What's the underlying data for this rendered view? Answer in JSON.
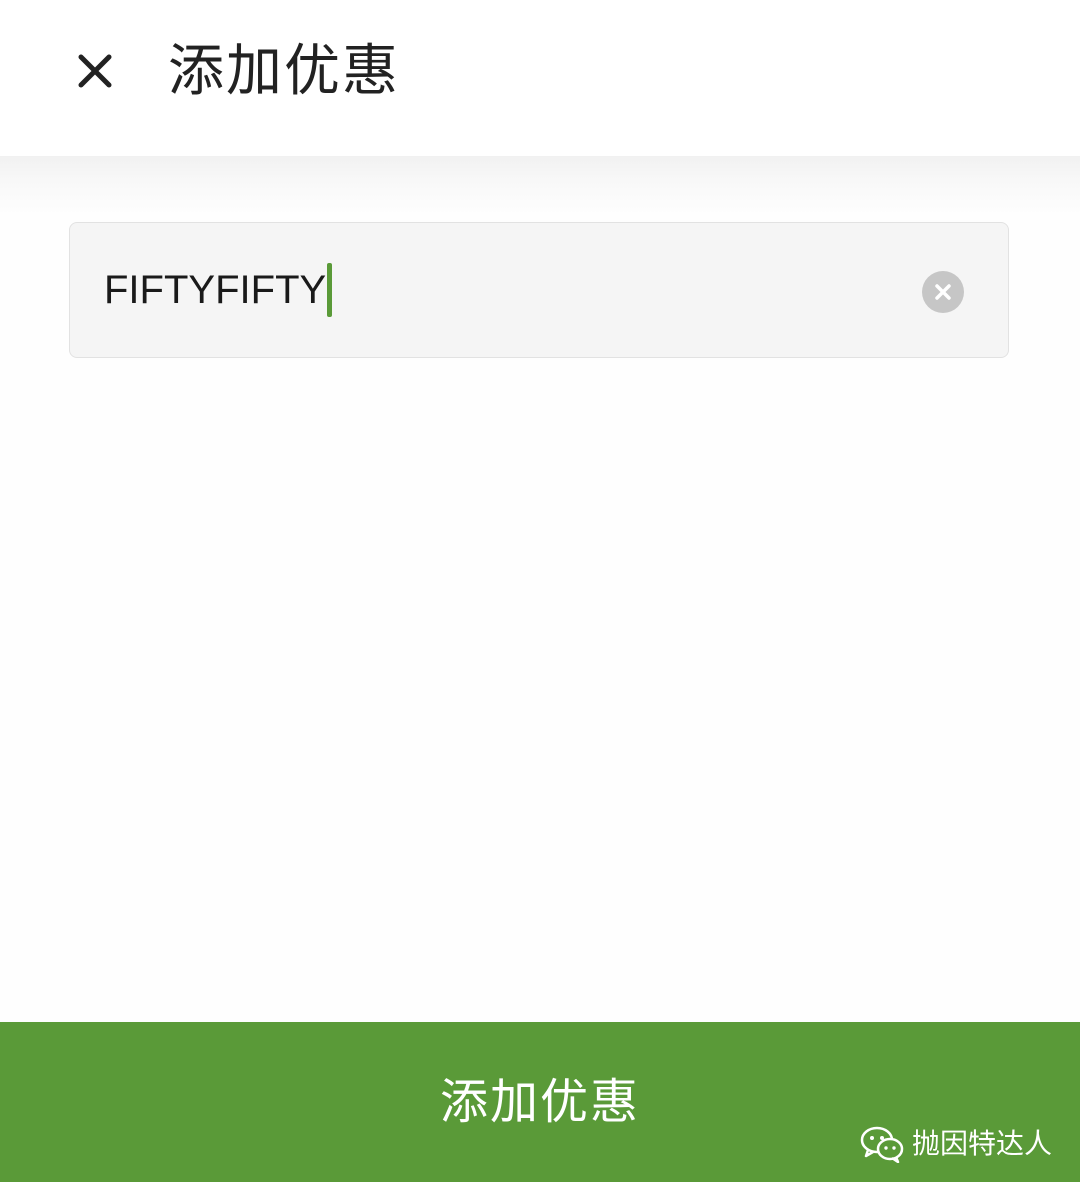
{
  "header": {
    "title": "添加优惠",
    "close_icon": "close-icon"
  },
  "promo_input": {
    "value": "FIFTYFIFTY",
    "clear_icon": "clear-circle-icon",
    "caret_color": "#5a9a38"
  },
  "submit": {
    "label": "添加优惠",
    "background_color": "#5a9a38"
  },
  "watermark": {
    "text": "抛因特达人",
    "icon": "wechat-icon"
  }
}
